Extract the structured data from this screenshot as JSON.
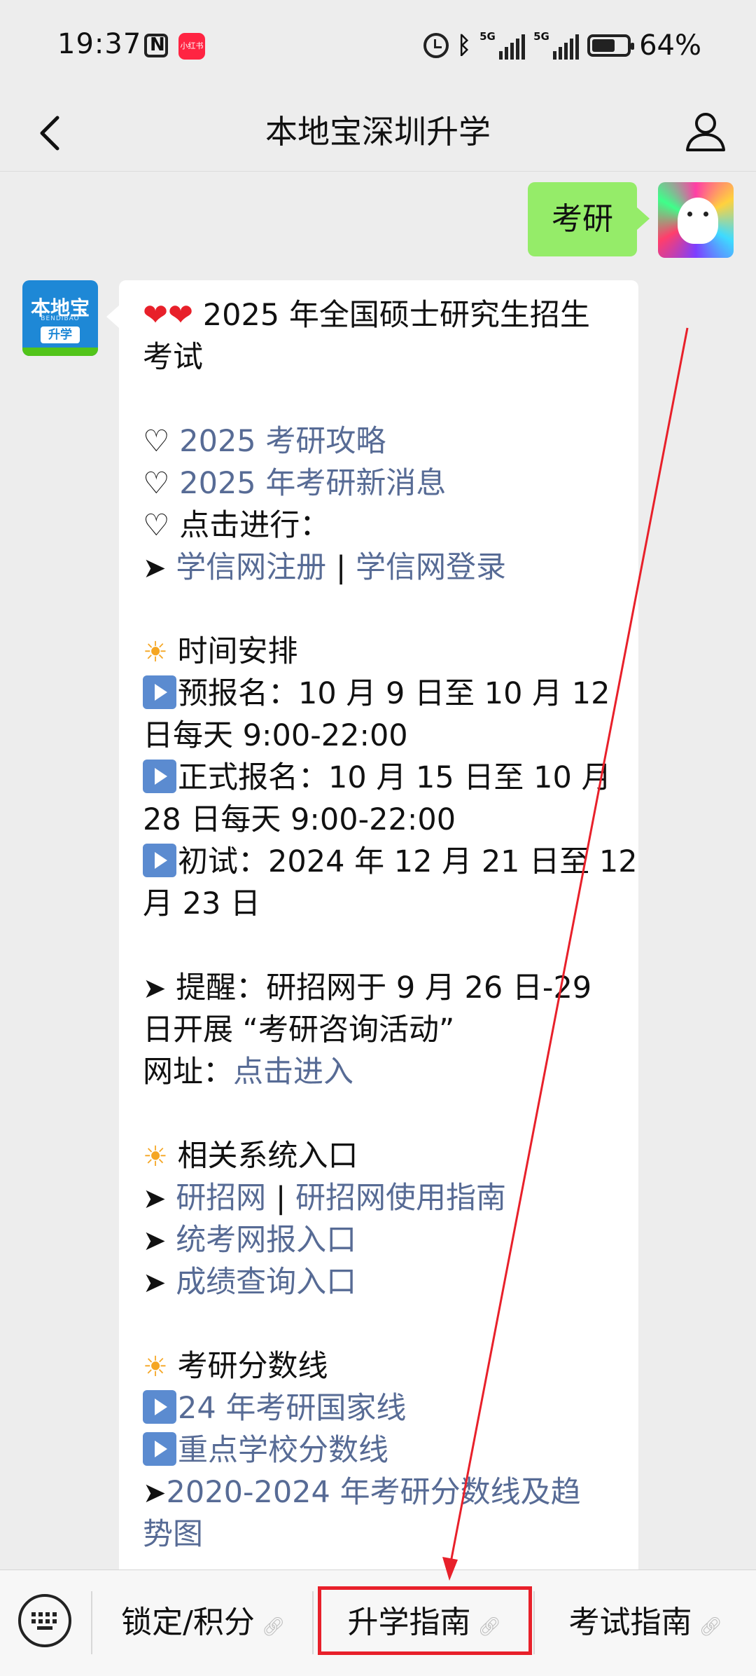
{
  "status_bar": {
    "time": "19:37",
    "battery": "64%",
    "network_1": "5G",
    "network_2": "5G",
    "app_icon": "小红书"
  },
  "nav": {
    "title": "本地宝深圳升学"
  },
  "chat": {
    "sent_message": "考研",
    "bot_avatar": {
      "brand": "本地宝",
      "sub": "BENDIBAO",
      "tag": "升学"
    },
    "message": {
      "title_line1": "2025 年全国硕士研究生招生",
      "title_line2": "考试",
      "link_guide": "2025 考研攻略",
      "link_news": "2025 年考研新消息",
      "click_to_do": "点击进行：",
      "link_register": "学信网注册",
      "sep": " | ",
      "link_login": "学信网登录",
      "schedule_heading": "时间安排",
      "pre_reg_line1": "预报名：10 月 9 日至 10 月 12",
      "pre_reg_line2": "日每天 9:00-22:00",
      "formal_reg_line1": "正式报名：10 月 15 日至 10 月",
      "formal_reg_line2": "28 日每天 9:00-22:00",
      "exam_line1": "初试：2024 年 12 月 21 日至 12",
      "exam_line2": "月 23 日",
      "reminder_line1": "提醒：研招网于 9 月 26 日-29",
      "reminder_line2": "日开展 “考研咨询活动”",
      "website_label": "网址：",
      "link_enter": "点击进入",
      "systems_heading": "相关系统入口",
      "link_yanzhao": "研招网",
      "link_yanzhao_guide": "研招网使用指南",
      "link_unified": "统考网报入口",
      "link_scores": "成绩查询入口",
      "scoreline_heading": "考研分数线",
      "link_national": "24 年考研国家线",
      "link_key_schools": "重点学校分数线",
      "link_trend_line1": "2020-2024 年考研分数线及趋",
      "link_trend_line2": "势图"
    }
  },
  "bottom_menu": {
    "item1": "锁定/积分",
    "item2": "升学指南",
    "item3": "考试指南"
  },
  "colors": {
    "link": "#576b95",
    "sent_bubble": "#95ec69",
    "annotation_red": "#e8202a"
  }
}
